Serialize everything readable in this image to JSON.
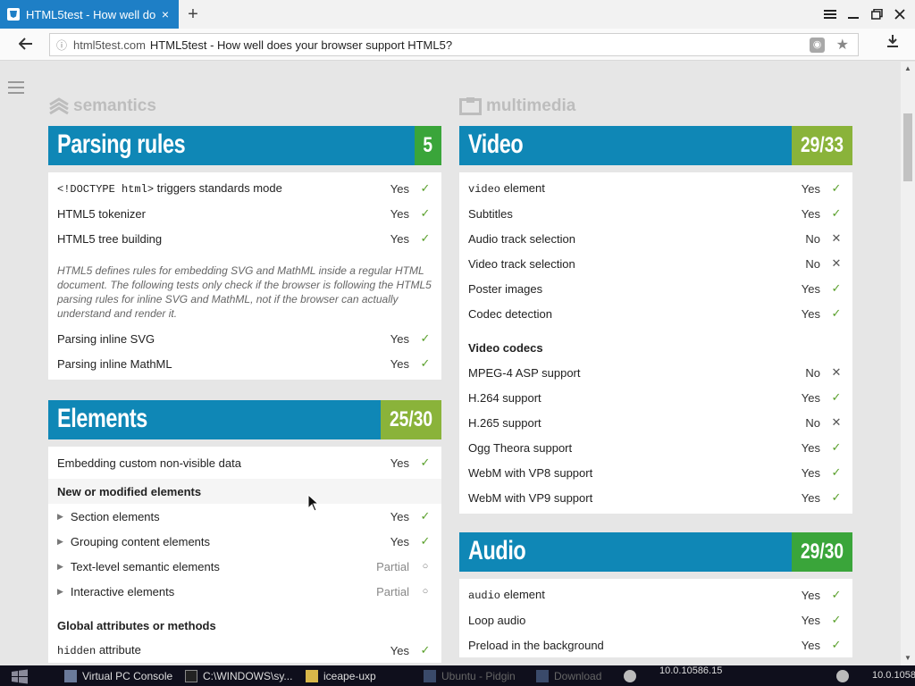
{
  "browser": {
    "tab_title": "HTML5test - How well do",
    "tab_close": "×",
    "new_tab": "+",
    "url_host": "html5test.com",
    "url_page": "HTML5test - How well does your browser support HTML5?",
    "icons": [
      "back-arrow-icon",
      "info-icon",
      "translate-icon",
      "star-icon",
      "download-icon",
      "menu-icon",
      "minimize-icon",
      "maximize-icon",
      "close-icon"
    ]
  },
  "page": {
    "categories": {
      "semantics": "semantics",
      "multimedia": "multimedia"
    },
    "parsing": {
      "title": "Parsing rules",
      "score": "5",
      "rows": [
        {
          "label_code": "<!DOCTYPE html>",
          "label": " triggers standards mode",
          "result": "Yes"
        },
        {
          "label": "HTML5 tokenizer",
          "result": "Yes"
        },
        {
          "label": "HTML5 tree building",
          "result": "Yes"
        }
      ],
      "note": "HTML5 defines rules for embedding SVG and MathML inside a regular HTML document. The following tests only check if the browser is following the HTML5 parsing rules for inline SVG and MathML, not if the browser can actually understand and render it.",
      "rows2": [
        {
          "label": "Parsing inline SVG",
          "result": "Yes"
        },
        {
          "label": "Parsing inline MathML",
          "result": "Yes"
        }
      ]
    },
    "elements": {
      "title": "Elements",
      "score": "25/30",
      "row_embed": {
        "label": "Embedding custom non-visible data",
        "result": "Yes"
      },
      "sub1": "New or modified elements",
      "items": [
        {
          "label": "Section elements",
          "result": "Yes"
        },
        {
          "label": "Grouping content elements",
          "result": "Yes"
        },
        {
          "label": "Text-level semantic elements",
          "result": "Partial"
        },
        {
          "label": "Interactive elements",
          "result": "Partial"
        }
      ],
      "sub2": "Global attributes or methods",
      "row_hidden": {
        "label_code": "hidden",
        "label": " attribute",
        "result": "Yes"
      }
    },
    "video": {
      "title": "Video",
      "score": "29/33",
      "rows": [
        {
          "label_code": "video",
          "label": " element",
          "result": "Yes"
        },
        {
          "label": "Subtitles",
          "result": "Yes"
        },
        {
          "label": "Audio track selection",
          "result": "No"
        },
        {
          "label": "Video track selection",
          "result": "No"
        },
        {
          "label": "Poster images",
          "result": "Yes"
        },
        {
          "label": "Codec detection",
          "result": "Yes"
        }
      ],
      "sub": "Video codecs",
      "codecs": [
        {
          "label": "MPEG-4 ASP support",
          "result": "No"
        },
        {
          "label": "H.264 support",
          "result": "Yes"
        },
        {
          "label": "H.265 support",
          "result": "No"
        },
        {
          "label": "Ogg Theora support",
          "result": "Yes"
        },
        {
          "label": "WebM with VP8 support",
          "result": "Yes"
        },
        {
          "label": "WebM with VP9 support",
          "result": "Yes"
        }
      ]
    },
    "audio": {
      "title": "Audio",
      "score": "29/30",
      "rows": [
        {
          "label_code": "audio",
          "label": " element",
          "result": "Yes"
        },
        {
          "label": "Loop audio",
          "result": "Yes"
        },
        {
          "label": "Preload in the background",
          "result": "Yes"
        }
      ]
    }
  },
  "colors": {
    "header_blue": "#0f87b6",
    "score_green": "#3aa53a",
    "score_olive": "#8ab33a",
    "tab_blue": "#1e7fc6"
  },
  "taskbar": {
    "items": [
      {
        "label": "Virtual PC Console"
      },
      {
        "label": "C:\\WINDOWS\\sy..."
      },
      {
        "label": "iceape-uxp"
      },
      {
        "label": "Ubuntu - Pidgin"
      },
      {
        "label": "Download"
      }
    ],
    "ip1": "10.0.10586.15",
    "ip2": "10.0.1058"
  }
}
